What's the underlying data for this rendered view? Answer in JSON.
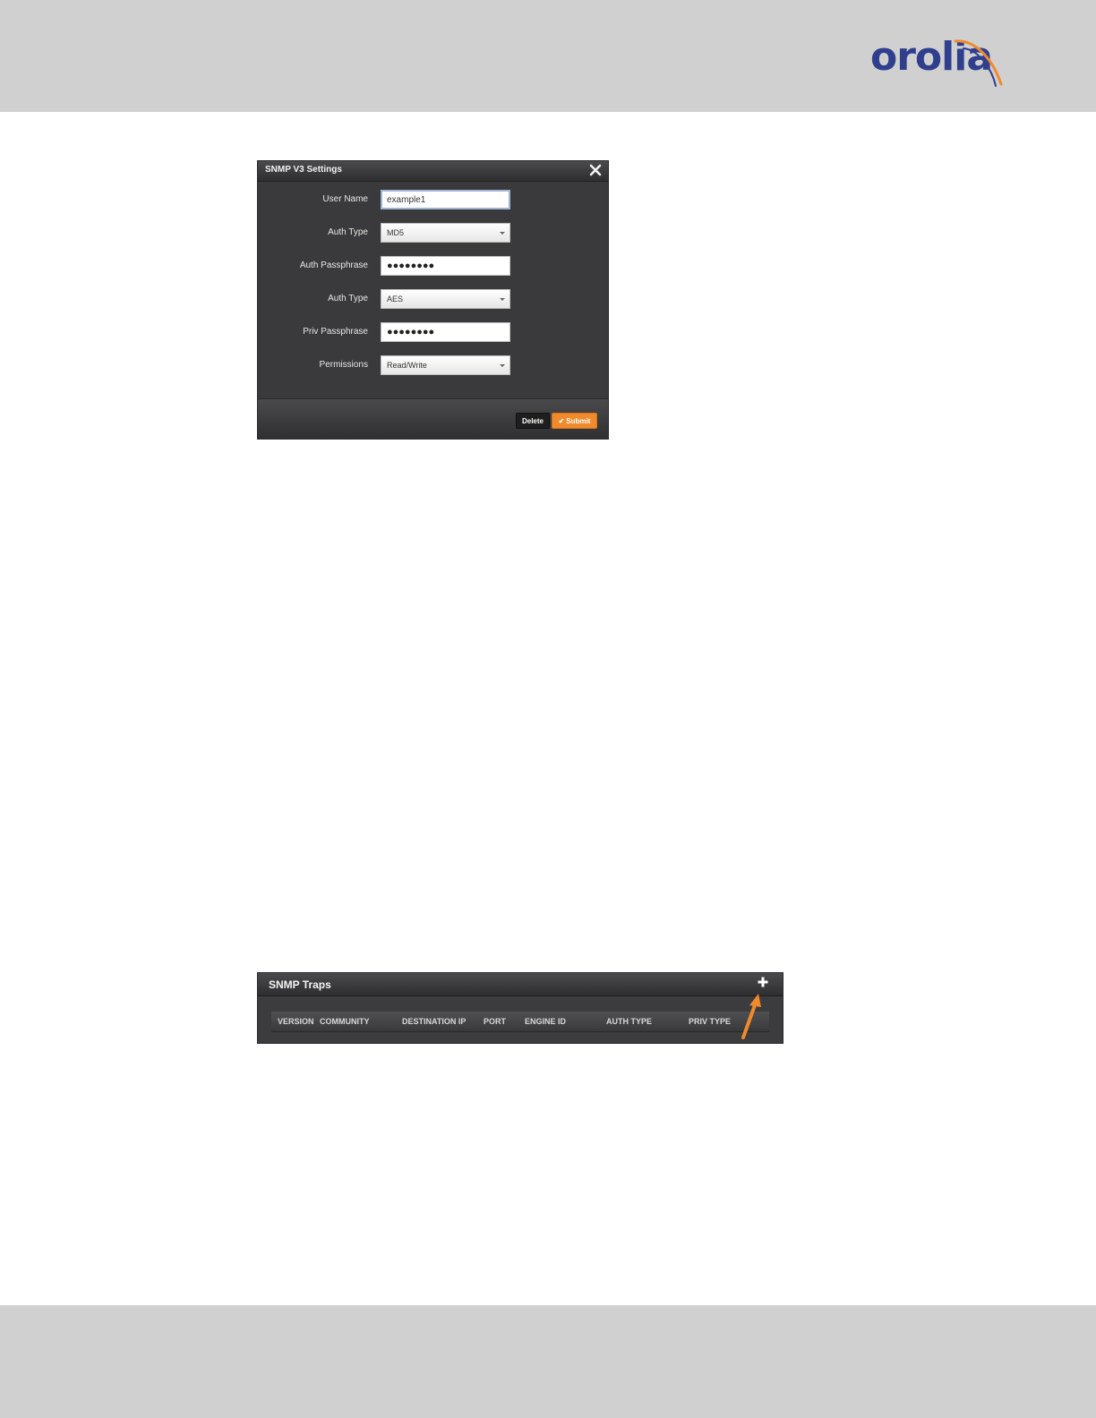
{
  "header": {
    "logo_text": "orolia"
  },
  "snmp_v3_dialog": {
    "title": "SNMP V3 Settings",
    "fields": [
      {
        "label": "User Name",
        "value": "example1",
        "kind": "text"
      },
      {
        "label": "Auth Type",
        "value": "MD5",
        "kind": "select"
      },
      {
        "label": "Auth Passphrase",
        "value": "●●●●●●●●",
        "kind": "password"
      },
      {
        "label": "Auth Type",
        "value": "AES",
        "kind": "select"
      },
      {
        "label": "Priv Passphrase",
        "value": "●●●●●●●●",
        "kind": "password"
      },
      {
        "label": "Permissions",
        "value": "Read/Write",
        "kind": "select"
      }
    ],
    "delete_label": "Delete",
    "submit_label": "Submit"
  },
  "snmp_traps_panel": {
    "title": "SNMP Traps",
    "columns": [
      "VERSION",
      "COMMUNITY",
      "DESTINATION IP",
      "PORT",
      "ENGINE ID",
      "AUTH TYPE",
      "PRIV TYPE"
    ]
  },
  "colors": {
    "brand_blue": "#2f3f8e",
    "brand_orange": "#f08a2c",
    "panel_dark": "#3a3a3c",
    "band_gray": "#d0d0d0"
  }
}
